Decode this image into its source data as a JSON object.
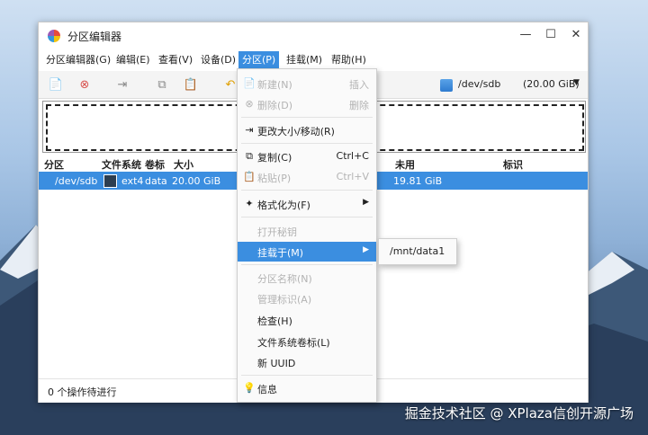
{
  "window": {
    "title": "分区编辑器",
    "controls": [
      "—",
      "☐",
      "✕"
    ]
  },
  "menubar": [
    "分区编辑器(G)",
    "编辑(E)",
    "查看(V)",
    "设备(D)",
    "分区(P)",
    "挂载(M)",
    "帮助(H)"
  ],
  "device": {
    "name": "/dev/sdb",
    "size": "(20.00 GiB)"
  },
  "table": {
    "headers": [
      "分区",
      "文件系统",
      "卷标",
      "大小",
      "未用",
      "标识"
    ],
    "row": {
      "partition": "/dev/sdb",
      "filesystem": "ext4",
      "label": "data",
      "size": "20.00 GiB",
      "unused": "19.81 GiB",
      "flags": ""
    }
  },
  "status": "0 个操作待进行",
  "context_menu": [
    {
      "label": "新建(N)",
      "shortcut": "插入",
      "disabled": true,
      "icon": "new-icon"
    },
    {
      "label": "删除(D)",
      "shortcut": "删除",
      "disabled": true,
      "icon": "delete-icon"
    },
    {
      "label": "更改大小/移动(R)",
      "shortcut": "",
      "disabled": false,
      "icon": "resize-icon"
    },
    {
      "label": "复制(C)",
      "shortcut": "Ctrl+C",
      "disabled": false,
      "icon": "copy-icon"
    },
    {
      "label": "粘贴(P)",
      "shortcut": "Ctrl+V",
      "disabled": true,
      "icon": "paste-icon"
    },
    {
      "label": "格式化为(F)",
      "shortcut": "",
      "disabled": false,
      "icon": "format-icon",
      "submenu": true
    },
    {
      "label": "打开秘钥",
      "shortcut": "",
      "disabled": true
    },
    {
      "label": "挂载于(M)",
      "shortcut": "",
      "disabled": false,
      "highlight": true,
      "submenu": true
    },
    {
      "label": "分区名称(N)",
      "shortcut": "",
      "disabled": true
    },
    {
      "label": "管理标识(A)",
      "shortcut": "",
      "disabled": true
    },
    {
      "label": "检查(H)",
      "shortcut": "",
      "disabled": false
    },
    {
      "label": "文件系统卷标(L)",
      "shortcut": "",
      "disabled": false
    },
    {
      "label": "新 UUID",
      "shortcut": "",
      "disabled": false
    },
    {
      "label": "信息",
      "shortcut": "",
      "disabled": false,
      "icon": "info-icon"
    }
  ],
  "submenu": {
    "item": "/mnt/data1"
  },
  "watermark": "掘金技术社区 @ XPlaza信创开源广场",
  "colors": {
    "accent": "#3b8ee0",
    "swatch": "#2d3e50"
  }
}
